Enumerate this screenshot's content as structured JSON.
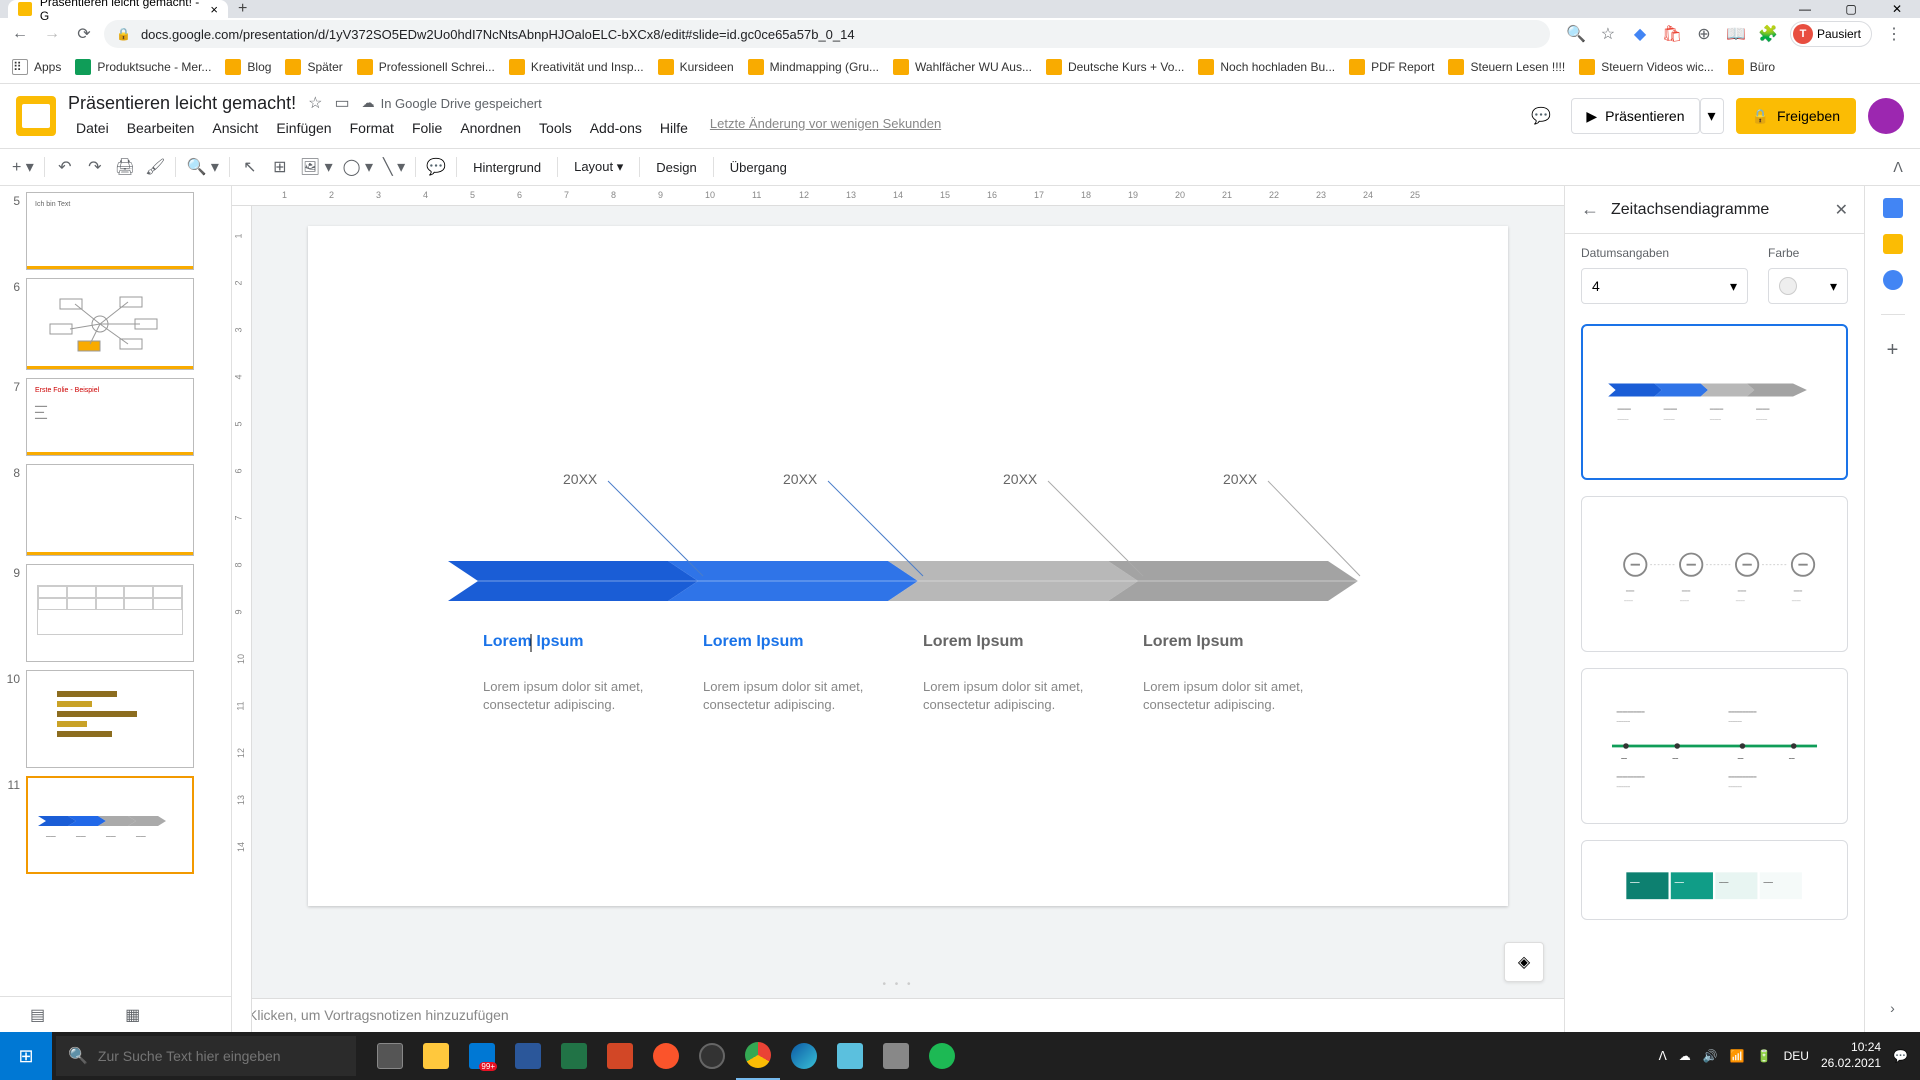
{
  "browser": {
    "tab_title": "Präsentieren leicht gemacht! - G",
    "url": "docs.google.com/presentation/d/1yV372SO5EDw2Uo0hdI7NcNtsAbnpHJOaloELC-bXCx8/edit#slide=id.gc0ce65a57b_0_14",
    "profile_letter": "T",
    "profile_status": "Pausiert",
    "bookmarks": [
      {
        "label": "Apps",
        "icon": "apps"
      },
      {
        "label": "Produktsuche - Mer...",
        "icon": "green"
      },
      {
        "label": "Blog",
        "icon": "std"
      },
      {
        "label": "Später",
        "icon": "std"
      },
      {
        "label": "Professionell Schrei...",
        "icon": "std"
      },
      {
        "label": "Kreativität und Insp...",
        "icon": "std"
      },
      {
        "label": "Kursideen",
        "icon": "std"
      },
      {
        "label": "Mindmapping (Gru...",
        "icon": "std"
      },
      {
        "label": "Wahlfächer WU Aus...",
        "icon": "std"
      },
      {
        "label": "Deutsche Kurs + Vo...",
        "icon": "std"
      },
      {
        "label": "Noch hochladen Bu...",
        "icon": "std"
      },
      {
        "label": "PDF Report",
        "icon": "std"
      },
      {
        "label": "Steuern Lesen !!!!",
        "icon": "std"
      },
      {
        "label": "Steuern Videos wic...",
        "icon": "std"
      },
      {
        "label": "Büro",
        "icon": "std"
      }
    ]
  },
  "app": {
    "doc_title": "Präsentieren leicht gemacht!",
    "drive_status": "In Google Drive gespeichert",
    "last_edit": "Letzte Änderung vor wenigen Sekunden",
    "present_label": "Präsentieren",
    "share_label": "Freigeben",
    "menus": [
      "Datei",
      "Bearbeiten",
      "Ansicht",
      "Einfügen",
      "Format",
      "Folie",
      "Anordnen",
      "Tools",
      "Add-ons",
      "Hilfe"
    ],
    "toolbar": {
      "background": "Hintergrund",
      "layout": "Layout",
      "design": "Design",
      "transition": "Übergang"
    }
  },
  "slides_list": [
    {
      "num": "5",
      "caption": "Ich bin Text"
    },
    {
      "num": "6",
      "caption": "Mindmap"
    },
    {
      "num": "7",
      "caption": "Erste Folie - Beispiel"
    },
    {
      "num": "8",
      "caption": ""
    },
    {
      "num": "9",
      "caption": ""
    },
    {
      "num": "10",
      "caption": ""
    },
    {
      "num": "11",
      "caption": ""
    }
  ],
  "canvas": {
    "ruler_h": [
      "1",
      "2",
      "3",
      "4",
      "5",
      "6",
      "7",
      "8",
      "9",
      "10",
      "11",
      "12",
      "13",
      "14",
      "15",
      "16",
      "17",
      "18",
      "19",
      "20",
      "21",
      "22",
      "23",
      "24",
      "25"
    ],
    "ruler_v": [
      "1",
      "2",
      "3",
      "4",
      "5",
      "6",
      "7",
      "8",
      "9",
      "10",
      "11",
      "12",
      "13",
      "14"
    ],
    "speaker_notes_placeholder": "Klicken, um Vortragsnotizen hinzuzufügen",
    "timeline": {
      "items": [
        {
          "year": "20XX",
          "title": "Lorem Ipsum",
          "desc1": "Lorem ipsum dolor sit amet,",
          "desc2": "consectetur adipiscing.",
          "color": "blue"
        },
        {
          "year": "20XX",
          "title": "Lorem Ipsum",
          "desc1": "Lorem ipsum dolor sit amet,",
          "desc2": "consectetur adipiscing.",
          "color": "blue"
        },
        {
          "year": "20XX",
          "title": "Lorem Ipsum",
          "desc1": "Lorem ipsum dolor sit amet,",
          "desc2": "consectetur adipiscing.",
          "color": "gray"
        },
        {
          "year": "20XX",
          "title": "Lorem Ipsum",
          "desc1": "Lorem ipsum dolor sit amet,",
          "desc2": "consectetur adipiscing.",
          "color": "gray"
        }
      ]
    }
  },
  "right_panel": {
    "title": "Zeitachsendiagramme",
    "dates_label": "Datumsangaben",
    "dates_value": "4",
    "color_label": "Farbe"
  },
  "taskbar": {
    "search_placeholder": "Zur Suche Text hier eingeben",
    "mail_count": "99+",
    "lang": "DEU",
    "time": "10:24",
    "date": "26.02.2021"
  },
  "chart_data": {
    "type": "timeline",
    "items_count": 4,
    "highlighted_count": 2,
    "accent_color": "#1a5dd6",
    "inactive_color": "#a8a8a8",
    "points": [
      {
        "label": "20XX",
        "title": "Lorem Ipsum",
        "active": true
      },
      {
        "label": "20XX",
        "title": "Lorem Ipsum",
        "active": true
      },
      {
        "label": "20XX",
        "title": "Lorem Ipsum",
        "active": false
      },
      {
        "label": "20XX",
        "title": "Lorem Ipsum",
        "active": false
      }
    ]
  }
}
